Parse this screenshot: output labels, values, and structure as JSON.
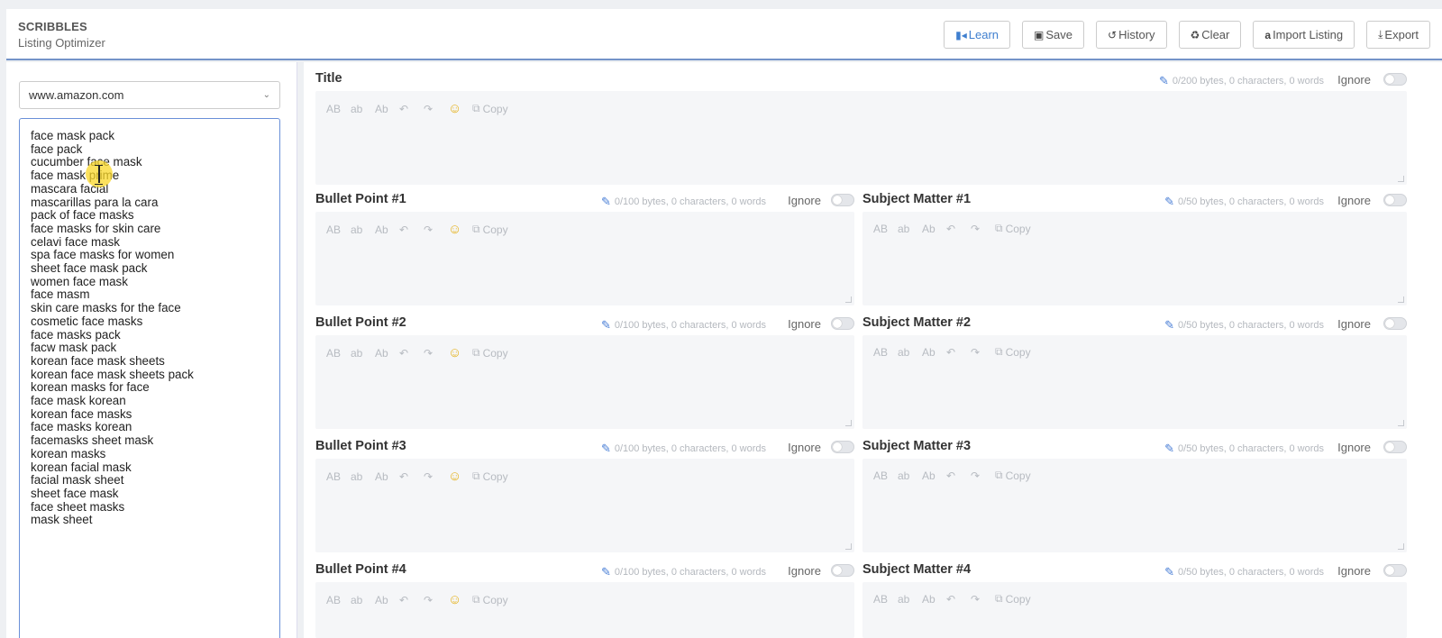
{
  "header": {
    "brand": "SCRIBBLES",
    "subtitle": "Listing Optimizer",
    "buttons": [
      {
        "label": "Learn",
        "icon": "video-icon"
      },
      {
        "label": "Save",
        "icon": "save-icon"
      },
      {
        "label": "History",
        "icon": "history-icon"
      },
      {
        "label": "Clear",
        "icon": "recycle-icon"
      },
      {
        "label": "Import Listing",
        "icon": "amazon-icon"
      },
      {
        "label": "Export",
        "icon": "download-icon"
      }
    ]
  },
  "marketplace": {
    "selected": "www.amazon.com"
  },
  "keywords": [
    "face mask pack",
    "face pack",
    "cucumber face mask",
    "face mask prime",
    "mascara facial",
    "mascarillas para la cara",
    "pack of face masks",
    "face masks for skin care",
    "celavi face mask",
    "spa face masks for women",
    "sheet face mask pack",
    "women face mask",
    "face masm",
    "skin care masks for the face",
    "cosmetic face masks",
    "face masks pack",
    "facw mask pack",
    "korean face mask sheets",
    "korean face mask sheets pack",
    "korean masks for face",
    "face mask korean",
    "korean face masks",
    "face masks korean",
    "facemasks sheet mask",
    "korean masks",
    "korean facial mask",
    "facial mask sheet",
    "sheet face mask",
    "face sheet masks",
    "mask sheet"
  ],
  "editor_tools": {
    "upper": "AB",
    "lower": "ab",
    "title": "Ab",
    "copy": "Copy"
  },
  "fields": {
    "title": {
      "label": "Title",
      "meta": "0/200 bytes, 0 characters, 0 words",
      "ignore": "Ignore"
    },
    "bullet1": {
      "label": "Bullet Point #1",
      "meta": "0/100 bytes, 0 characters, 0 words",
      "ignore": "Ignore"
    },
    "bullet2": {
      "label": "Bullet Point #2",
      "meta": "0/100 bytes, 0 characters, 0 words",
      "ignore": "Ignore"
    },
    "bullet3": {
      "label": "Bullet Point #3",
      "meta": "0/100 bytes, 0 characters, 0 words",
      "ignore": "Ignore"
    },
    "bullet4": {
      "label": "Bullet Point #4",
      "meta": "0/100 bytes, 0 characters, 0 words",
      "ignore": "Ignore"
    },
    "subject1": {
      "label": "Subject Matter #1",
      "meta": "0/50 bytes, 0 characters, 0 words",
      "ignore": "Ignore"
    },
    "subject2": {
      "label": "Subject Matter #2",
      "meta": "0/50 bytes, 0 characters, 0 words",
      "ignore": "Ignore"
    },
    "subject3": {
      "label": "Subject Matter #3",
      "meta": "0/50 bytes, 0 characters, 0 words",
      "ignore": "Ignore"
    },
    "subject4": {
      "label": "Subject Matter #4",
      "meta": "0/50 bytes, 0 characters, 0 words",
      "ignore": "Ignore"
    }
  },
  "colors": {
    "accent": "#3f7fcf",
    "header_border": "#7393c8",
    "emoji": "#e5b21d"
  }
}
